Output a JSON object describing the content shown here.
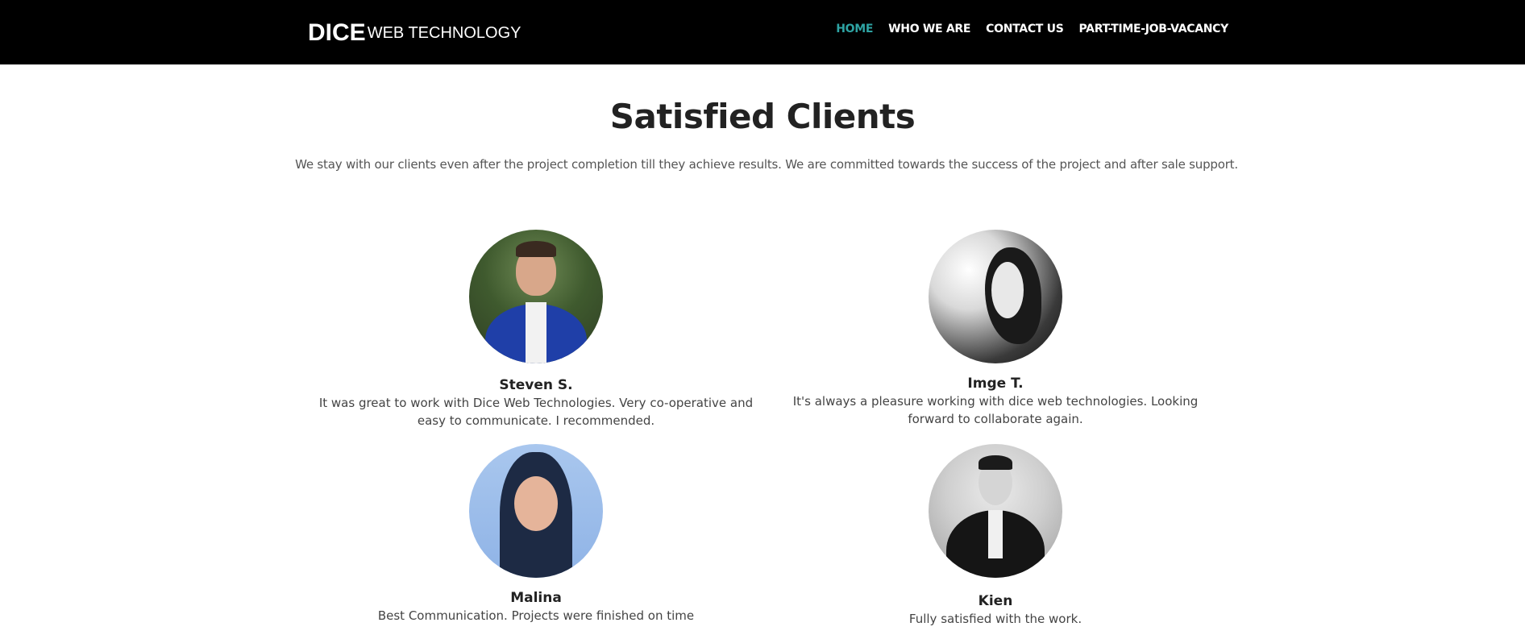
{
  "header": {
    "logo_mark": "DICE",
    "logo_text": "WEB TECHNOLOGY",
    "nav": [
      {
        "label": "HOME",
        "active": true
      },
      {
        "label": "WHO WE ARE",
        "active": false
      },
      {
        "label": "CONTACT US",
        "active": false
      },
      {
        "label": "PART-TIME-JOB-VACANCY",
        "active": false
      }
    ]
  },
  "section": {
    "title": "Satisfied Clients",
    "subtitle": "We stay with our clients even after the project completion till they achieve results. We are committed towards the success of the project and after sale support."
  },
  "clients": [
    {
      "name": "Steven S.",
      "text": "It was great to work with Dice Web Technologies. Very co-operative and easy to communicate. I recommended."
    },
    {
      "name": "Imge T.",
      "text": "It's always a pleasure working with dice web technologies. Looking forward to collaborate again."
    },
    {
      "name": "Malina",
      "text": "Best Communication. Projects were finished on time"
    },
    {
      "name": "Kien",
      "text": "Fully satisfied with the work."
    }
  ],
  "colors": {
    "header_bg": "#000000",
    "nav_active": "#2ea3a3",
    "nav_text": "#ffffff",
    "logo_accent": "#8a3ac4"
  }
}
